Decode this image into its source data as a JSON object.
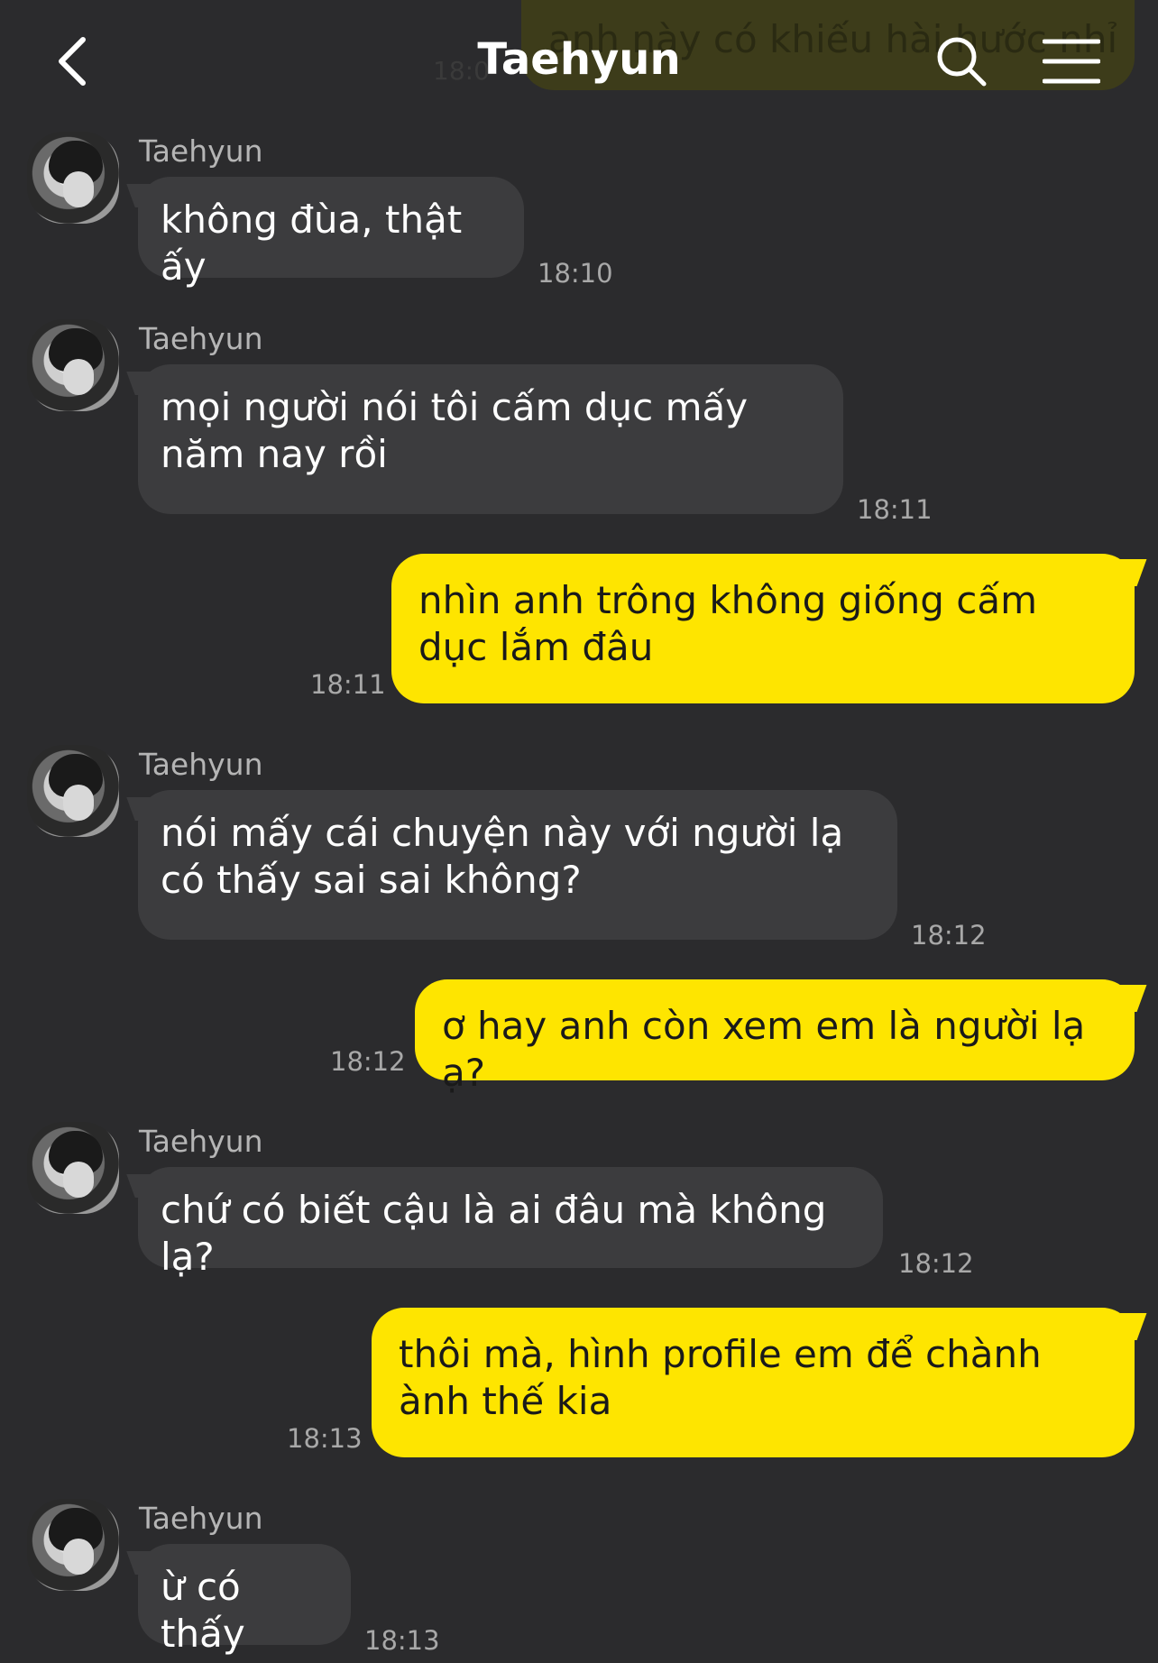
{
  "header": {
    "title": "Taehyun",
    "back_icon": "chevron-left-icon",
    "search_icon": "search-icon",
    "menu_icon": "hamburger-menu-icon"
  },
  "top_partial": {
    "text": "anh này có khiếu hài hước nhỉ",
    "time": "18:0"
  },
  "messages": [
    {
      "direction": "in",
      "sender": "Taehyun",
      "text": "không đùa, thật ấy",
      "time": "18:10"
    },
    {
      "direction": "in",
      "sender": "Taehyun",
      "text": "mọi người nói tôi cấm dục mấy năm nay rồi",
      "time": "18:11"
    },
    {
      "direction": "out",
      "text": "nhìn anh trông không giống cấm dục lắm đâu",
      "time": "18:11"
    },
    {
      "direction": "in",
      "sender": "Taehyun",
      "text": "nói mấy cái chuyện này với người lạ có thấy sai sai không?",
      "time": "18:12"
    },
    {
      "direction": "out",
      "text": "ơ hay anh còn xem em là người lạ ạ?",
      "time": "18:12"
    },
    {
      "direction": "in",
      "sender": "Taehyun",
      "text": "chứ có biết cậu là ai đâu mà không lạ?",
      "time": "18:12"
    },
    {
      "direction": "out",
      "text": "thôi mà, hình profile em để chành ành thế kia",
      "time": "18:13"
    },
    {
      "direction": "in",
      "sender": "Taehyun",
      "text": "ừ có thấy",
      "time": "18:13"
    }
  ],
  "colors": {
    "background": "#2b2b2d",
    "incoming_bubble": "#3c3c3e",
    "outgoing_bubble": "#fee500"
  }
}
